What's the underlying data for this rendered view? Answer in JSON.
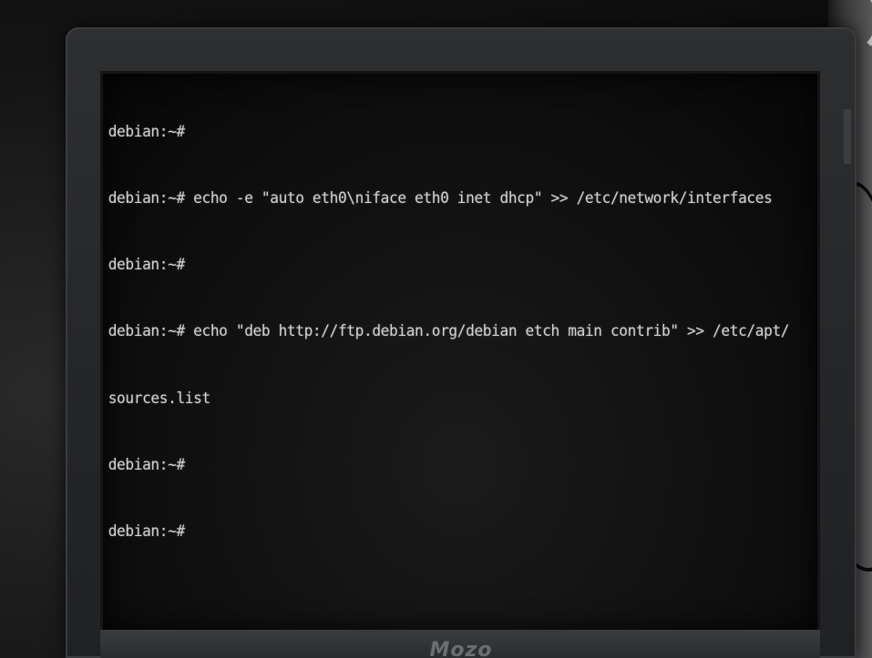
{
  "terminal": {
    "lines": [
      "debian:~#",
      "debian:~# echo -e \"auto eth0\\niface eth0 inet dhcp\" >> /etc/network/interfaces",
      "debian:~#",
      "debian:~# echo \"deb http://ftp.debian.org/debian etch main contrib\" >> /etc/apt/",
      "sources.list",
      "debian:~#",
      "debian:~#"
    ]
  },
  "monitor": {
    "brand": "Mozo"
  },
  "colors": {
    "terminal_text": "#d2d2d2",
    "screen_background": "#101010",
    "bezel": "#2a2c2f"
  }
}
